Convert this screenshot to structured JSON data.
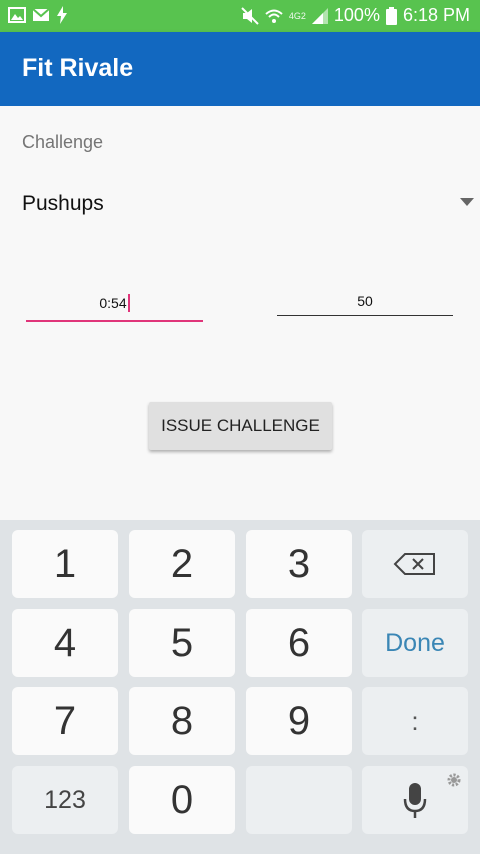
{
  "status_bar": {
    "battery": "100%",
    "time": "6:18 PM",
    "network": "4G2"
  },
  "app_bar": {
    "title": "Fit Rivale"
  },
  "form": {
    "challenge_label": "Challenge",
    "challenge_selected": "Pushups",
    "time_value": "0:54",
    "count_value": "50",
    "issue_button": "ISSUE CHALLENGE"
  },
  "keyboard": {
    "k1": "1",
    "k2": "2",
    "k3": "3",
    "k4": "4",
    "k5": "5",
    "k6": "6",
    "k7": "7",
    "k8": "8",
    "k9": "9",
    "k0": "0",
    "done": "Done",
    "colon": ":",
    "mode": "123"
  },
  "colors": {
    "status_bar": "#58c34f",
    "app_bar": "#1268c0",
    "focus_underline": "#e0357a",
    "done_text": "#3a86b5"
  }
}
